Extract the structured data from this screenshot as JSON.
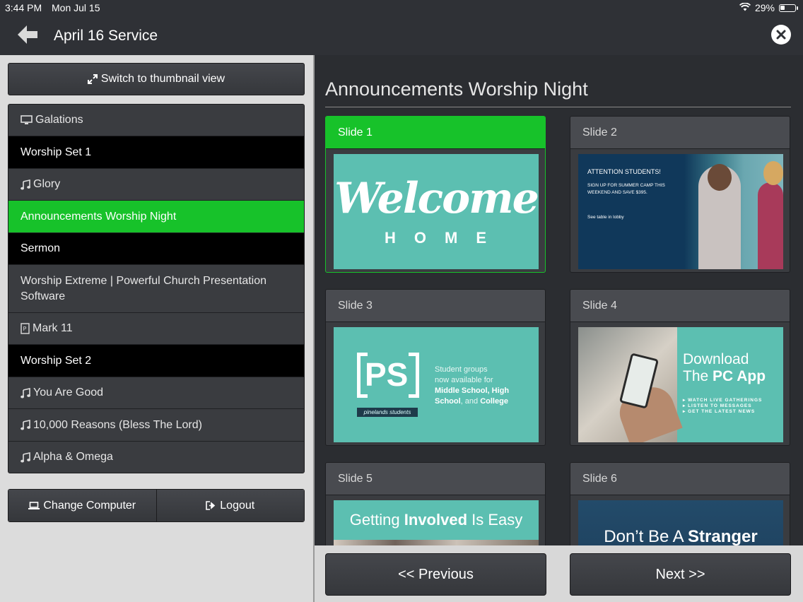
{
  "status_bar": {
    "time": "3:44 PM",
    "date": "Mon Jul 15",
    "battery_text": "29%",
    "battery_level": 0.29,
    "wifi_icon": "wifi-icon",
    "battery_icon": "battery-icon"
  },
  "header": {
    "title": "April 16 Service",
    "back_icon": "back-arrow-icon",
    "close_icon": "close-icon"
  },
  "left": {
    "switch_label": "Switch to thumbnail view",
    "items": [
      {
        "label": "Galations",
        "icon": "monitor-icon",
        "style": "normal"
      },
      {
        "label": "Worship Set 1",
        "icon": "",
        "style": "header"
      },
      {
        "label": "Glory",
        "icon": "music-note-icon",
        "style": "normal"
      },
      {
        "label": "Announcements Worship Night",
        "icon": "",
        "style": "active"
      },
      {
        "label": "Sermon",
        "icon": "",
        "style": "header"
      },
      {
        "label": "Worship Extreme | Powerful Church Presentation Software",
        "icon": "",
        "style": "normal"
      },
      {
        "label": "Mark 11",
        "icon": "scripture-icon",
        "style": "normal"
      },
      {
        "label": "Worship Set 2",
        "icon": "",
        "style": "header"
      },
      {
        "label": "You Are Good",
        "icon": "music-note-icon",
        "style": "normal"
      },
      {
        "label": "10,000 Reasons (Bless The Lord)",
        "icon": "music-note-icon",
        "style": "normal"
      },
      {
        "label": "Alpha & Omega",
        "icon": "music-note-icon",
        "style": "normal"
      }
    ],
    "change_computer_label": "Change Computer",
    "logout_label": "Logout"
  },
  "main": {
    "title": "Announcements Worship Night",
    "slides": [
      {
        "label": "Slide 1",
        "active": true
      },
      {
        "label": "Slide 2",
        "active": false
      },
      {
        "label": "Slide 3",
        "active": false
      },
      {
        "label": "Slide 4",
        "active": false
      },
      {
        "label": "Slide 5",
        "active": false
      },
      {
        "label": "Slide 6",
        "active": false
      }
    ],
    "slide1": {
      "welcome": "Welcome",
      "home": "HOME"
    },
    "slide2": {
      "heading": "ATTENTION STUDENTS!",
      "body": "SIGN UP FOR SUMMER CAMP THIS WEEKEND AND SAVE $395.",
      "footer": "See table in lobby"
    },
    "slide3": {
      "logo": "PS",
      "banner": "pinelands students",
      "line1": "Student groups",
      "line2": "now available for",
      "bold1": "Middle School, High",
      "bold2": "School",
      "and": ", and ",
      "bold3": "College"
    },
    "slide4": {
      "line1": "Download",
      "line2_prefix": "The ",
      "line2_bold": "PC App",
      "bullets": [
        "WATCH LIVE GATHERINGS",
        "LISTEN TO MESSAGES",
        "GET THE LATEST NEWS"
      ]
    },
    "slide5": {
      "prefix": "Getting ",
      "bold": "Involved",
      "suffix": " Is Easy"
    },
    "slide6": {
      "prefix": "Don’t Be A ",
      "bold": "Stranger"
    }
  },
  "footer": {
    "previous_label": "<< Previous",
    "next_label": "Next >>"
  },
  "colors": {
    "accent_green": "#17c22a",
    "panel_dark": "#2b2d31",
    "teal": "#5cbfb1"
  }
}
